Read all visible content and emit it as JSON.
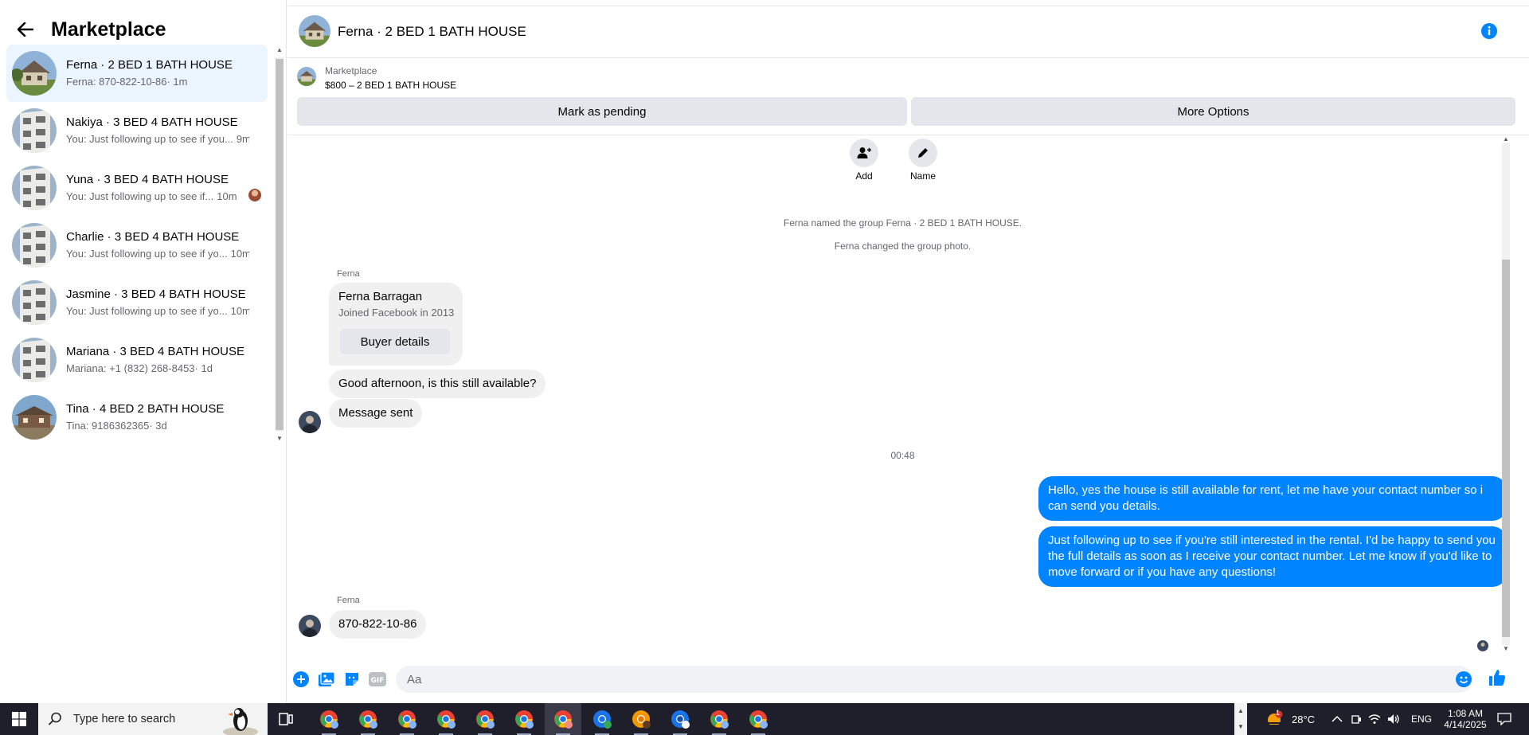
{
  "sidebar": {
    "title": "Marketplace",
    "conversations": [
      {
        "name": "Ferna · 2 BED 1 BATH HOUSE",
        "snippet": "Ferna: 870-822-10-86",
        "time": "· 1m",
        "active": true
      },
      {
        "name": "Nakiya · 3 BED 4 BATH HOUSE",
        "snippet": "You: Just following up to see if you...",
        "time": "9m"
      },
      {
        "name": "Yuna · 3 BED 4 BATH HOUSE",
        "snippet": "You: Just following up to see if...",
        "time": "10m"
      },
      {
        "name": "Charlie · 3 BED 4 BATH HOUSE",
        "snippet": "You: Just following up to see if yo...",
        "time": "10m"
      },
      {
        "name": "Jasmine · 3 BED 4 BATH HOUSE",
        "snippet": "You: Just following up to see if yo...",
        "time": "10m"
      },
      {
        "name": "Mariana · 3 BED 4 BATH HOUSE",
        "snippet": "Mariana: +1 (832) 268-8453",
        "time": "· 1d"
      },
      {
        "name": "Tina · 4 BED 2 BATH HOUSE",
        "snippet": "Tina: 9186362365",
        "time": "· 3d"
      }
    ]
  },
  "chat": {
    "title": "Ferna · 2 BED 1 BATH HOUSE",
    "marketplace_label": "Marketplace",
    "listing": "$800 – 2 BED 1 BATH HOUSE",
    "mark_pending": "Mark as pending",
    "more_options": "More Options",
    "add_label": "Add",
    "name_label": "Name",
    "system_1": "Ferna named the group Ferna · 2 BED 1 BATH HOUSE.",
    "system_2": "Ferna changed the group photo.",
    "sender_1": "Ferna",
    "card_name": "Ferna Barragan",
    "card_sub": "Joined Facebook in 2013",
    "card_button": "Buyer details",
    "msg_1": "Good afternoon, is this still available?",
    "msg_2": "Message sent",
    "timestamp": "00:48",
    "out_1": "Hello, yes the house is still available for rent, let me have your contact number so i can send you details.",
    "out_2": "Just following up to see if you're still interested in the rental. I'd be happy to send you the full details as soon as I receive your contact number. Let me know if you'd like to move forward or if you have any questions!",
    "sender_2": "Ferna",
    "msg_3": "870-822-10-86",
    "composer_placeholder": "Aa"
  },
  "taskbar": {
    "search_placeholder": "Type here to search",
    "weather": "28°C",
    "weather_badge": "1",
    "lang": "ENG",
    "time": "1:08 AM",
    "date": "4/14/2025"
  },
  "colors": {
    "accent": "#0084ff",
    "bubble_in": "#f0f0f0",
    "active_row": "#ebf5ff"
  }
}
